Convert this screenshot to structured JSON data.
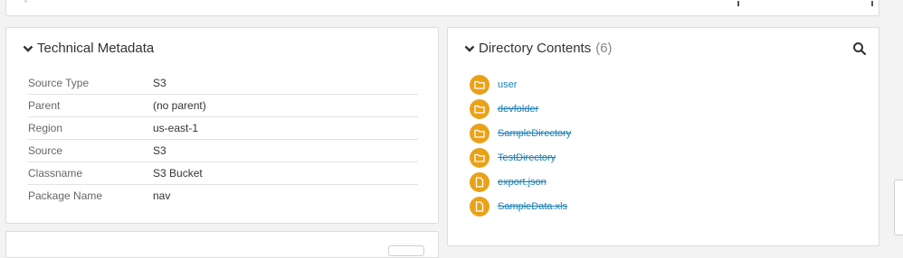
{
  "technical_metadata": {
    "title": "Technical Metadata",
    "rows": [
      {
        "key": "Source Type",
        "value": "S3"
      },
      {
        "key": "Parent",
        "value": "(no parent)"
      },
      {
        "key": "Region",
        "value": "us-east-1"
      },
      {
        "key": "Source",
        "value": "S3"
      },
      {
        "key": "Classname",
        "value": "S3 Bucket"
      },
      {
        "key": "Package Name",
        "value": "nav"
      }
    ]
  },
  "directory_contents": {
    "title": "Directory Contents",
    "count": "(6)",
    "search_icon": "search-icon",
    "items": [
      {
        "name": "user",
        "type": "folder",
        "deleted": false
      },
      {
        "name": "devfolder",
        "type": "folder",
        "deleted": true
      },
      {
        "name": "SampleDirectory",
        "type": "folder",
        "deleted": true
      },
      {
        "name": "TestDirectory",
        "type": "folder",
        "deleted": true
      },
      {
        "name": "export.json",
        "type": "file",
        "deleted": true
      },
      {
        "name": "SampleData.xls",
        "type": "file",
        "deleted": true
      }
    ]
  },
  "colors": {
    "accent": "#e9a218",
    "link": "#1a7fb5"
  }
}
